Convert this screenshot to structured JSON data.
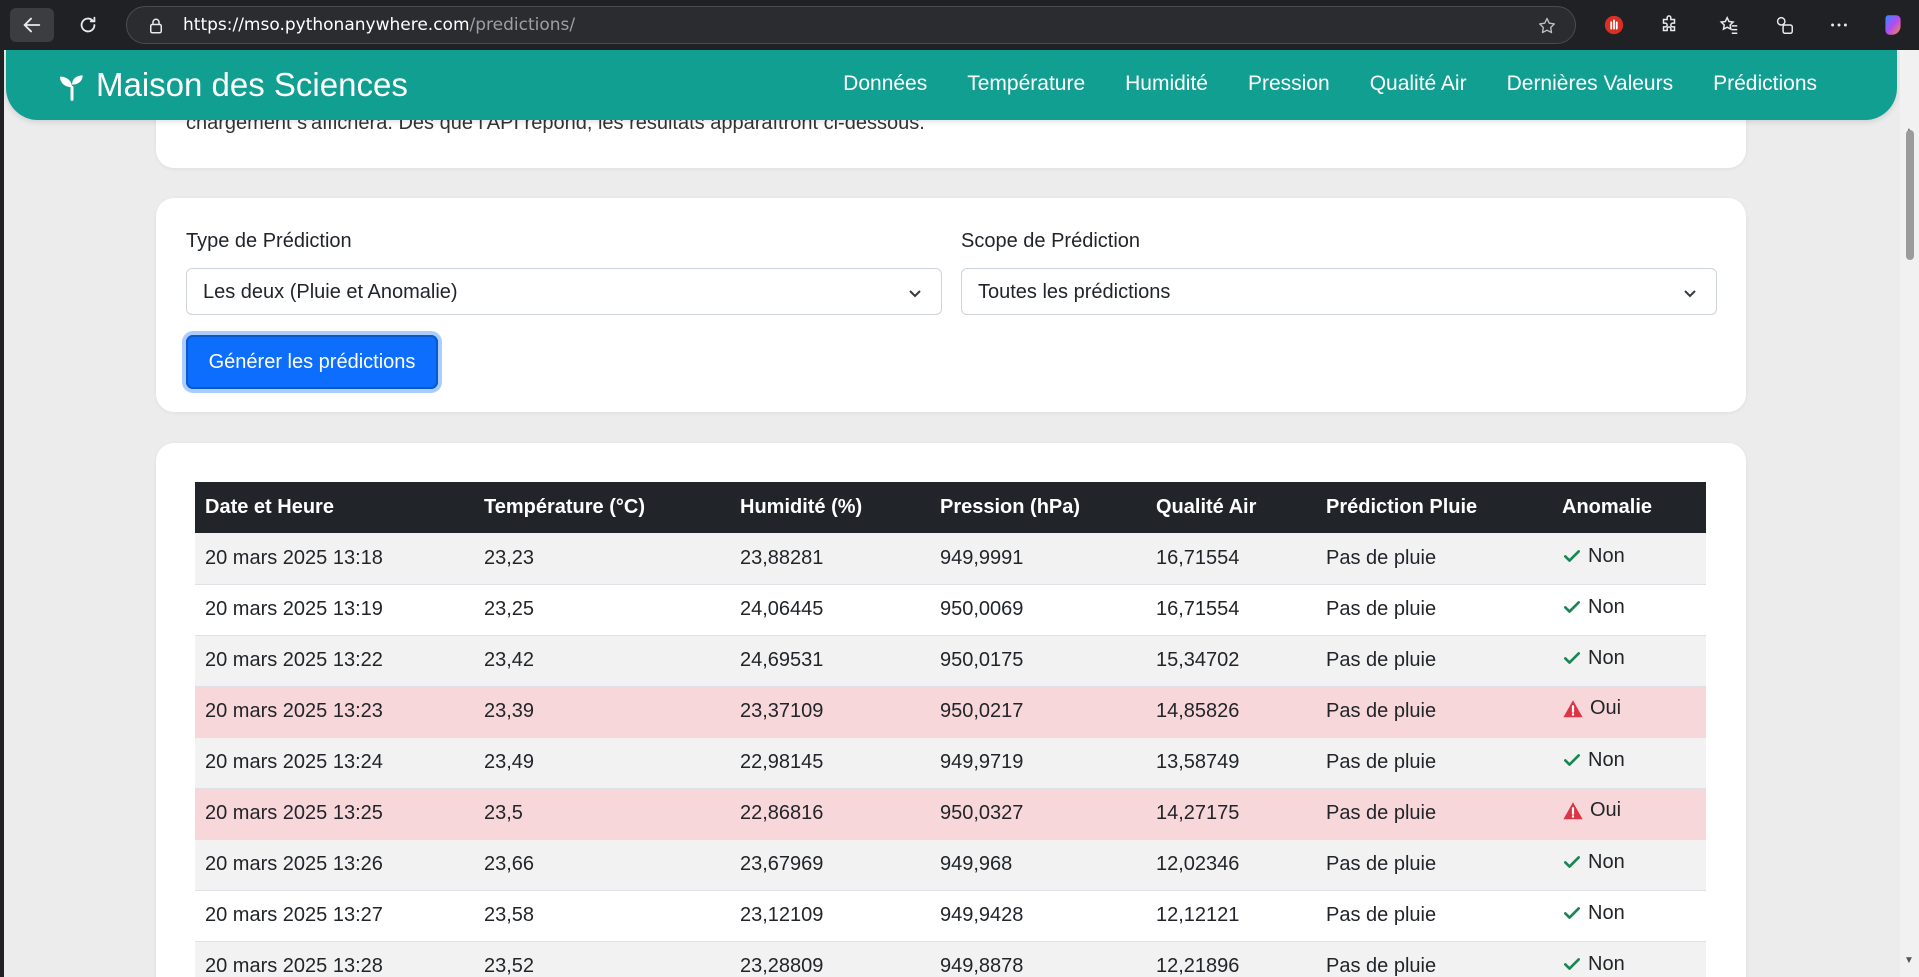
{
  "browser": {
    "url_domain": "https://mso.pythonanywhere.com",
    "url_path": "/predictions/"
  },
  "navbar": {
    "brand": "Maison des Sciences",
    "links": [
      "Données",
      "Température",
      "Humidité",
      "Pression",
      "Qualité Air",
      "Dernières Valeurs",
      "Prédictions"
    ]
  },
  "intro": {
    "text": "chargement s'affichera. Dès que l'API répond, les résultats apparaîtront ci-dessous."
  },
  "form": {
    "type_label": "Type de Prédiction",
    "type_value": "Les deux (Pluie et Anomalie)",
    "scope_label": "Scope de Prédiction",
    "scope_value": "Toutes les prédictions",
    "generate_label": "Générer les prédictions"
  },
  "table": {
    "headers": [
      "Date et Heure",
      "Température (°C)",
      "Humidité (%)",
      "Pression (hPa)",
      "Qualité Air",
      "Prédiction Pluie",
      "Anomalie"
    ],
    "rows": [
      {
        "date": "20 mars 2025 13:18",
        "temp": "23,23",
        "hum": "23,88281",
        "press": "949,9991",
        "air": "16,71554",
        "rain": "Pas de pluie",
        "anomaly": "Non",
        "is_anomaly": false
      },
      {
        "date": "20 mars 2025 13:19",
        "temp": "23,25",
        "hum": "24,06445",
        "press": "950,0069",
        "air": "16,71554",
        "rain": "Pas de pluie",
        "anomaly": "Non",
        "is_anomaly": false
      },
      {
        "date": "20 mars 2025 13:22",
        "temp": "23,42",
        "hum": "24,69531",
        "press": "950,0175",
        "air": "15,34702",
        "rain": "Pas de pluie",
        "anomaly": "Non",
        "is_anomaly": false
      },
      {
        "date": "20 mars 2025 13:23",
        "temp": "23,39",
        "hum": "23,37109",
        "press": "950,0217",
        "air": "14,85826",
        "rain": "Pas de pluie",
        "anomaly": "Oui",
        "is_anomaly": true
      },
      {
        "date": "20 mars 2025 13:24",
        "temp": "23,49",
        "hum": "22,98145",
        "press": "949,9719",
        "air": "13,58749",
        "rain": "Pas de pluie",
        "anomaly": "Non",
        "is_anomaly": false
      },
      {
        "date": "20 mars 2025 13:25",
        "temp": "23,5",
        "hum": "22,86816",
        "press": "950,0327",
        "air": "14,27175",
        "rain": "Pas de pluie",
        "anomaly": "Oui",
        "is_anomaly": true
      },
      {
        "date": "20 mars 2025 13:26",
        "temp": "23,66",
        "hum": "23,67969",
        "press": "949,968",
        "air": "12,02346",
        "rain": "Pas de pluie",
        "anomaly": "Non",
        "is_anomaly": false
      },
      {
        "date": "20 mars 2025 13:27",
        "temp": "23,58",
        "hum": "23,12109",
        "press": "949,9428",
        "air": "12,12121",
        "rain": "Pas de pluie",
        "anomaly": "Non",
        "is_anomaly": false
      },
      {
        "date": "20 mars 2025 13:28",
        "temp": "23,52",
        "hum": "23,28809",
        "press": "949,8878",
        "air": "12,21896",
        "rain": "Pas de pluie",
        "anomaly": "Non",
        "is_anomaly": false
      }
    ]
  },
  "colors": {
    "navbar": "#119f91",
    "button": "#0d6efd",
    "anomaly_row": "#f8d7da",
    "check": "#198754",
    "warning": "#dc3545"
  }
}
